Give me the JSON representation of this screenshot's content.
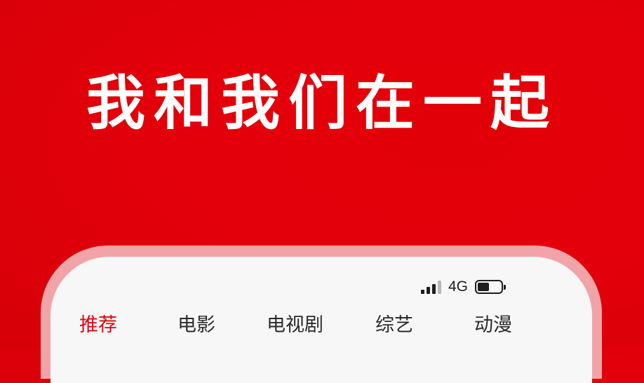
{
  "headline": "我和我们在一起",
  "colors": {
    "background": "#e4000a",
    "active_tab": "#e4000a",
    "phone_frame": "#f1a4a7",
    "screen": "#f7f7f7",
    "text": "#2b2b2b"
  },
  "status_bar": {
    "signal_icon": "signal-bars-icon",
    "signal_bars_filled": 3,
    "signal_bars_total": 4,
    "network": "4G",
    "battery_icon": "battery-icon",
    "battery_level": 0.5
  },
  "tabs": [
    {
      "label": "推荐",
      "active": true
    },
    {
      "label": "电影",
      "active": false
    },
    {
      "label": "电视剧",
      "active": false
    },
    {
      "label": "综艺",
      "active": false
    },
    {
      "label": "动漫",
      "active": false
    }
  ]
}
